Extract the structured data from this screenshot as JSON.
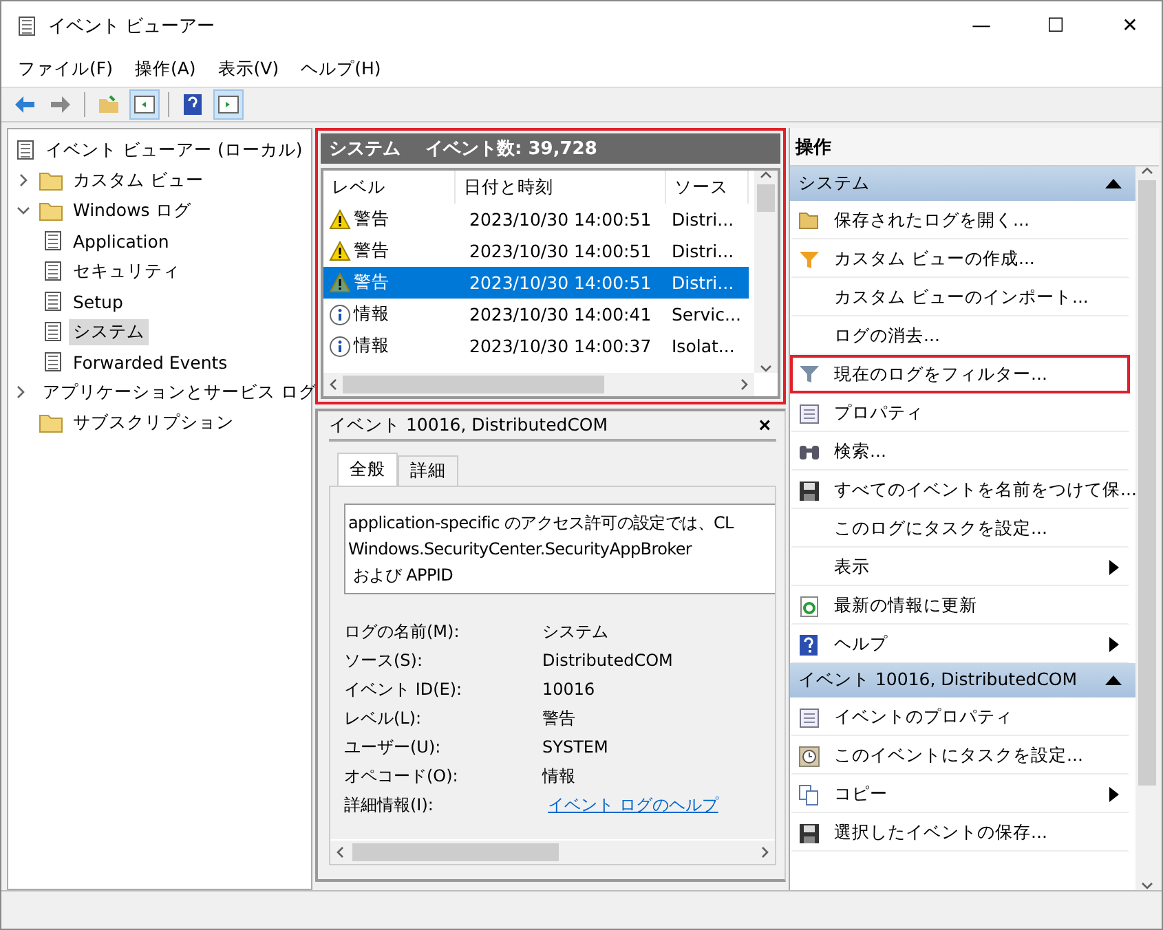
{
  "window": {
    "title": "イベント ビューアー",
    "controls": [
      "—",
      "☐",
      "✕"
    ]
  },
  "menu": [
    "ファイル(F)",
    "操作(A)",
    "表示(V)",
    "ヘルプ(H)"
  ],
  "tree": [
    {
      "label": "イベント ビューアー (ローカル)",
      "selected": false,
      "children": [
        {
          "label": "カスタム ビュー",
          "selected": false,
          "expanded": false
        },
        {
          "label": "Windows ログ",
          "selected": false,
          "expanded": true,
          "children": [
            {
              "label": "Application",
              "selected": false
            },
            {
              "label": "セキュリティ",
              "selected": false
            },
            {
              "label": "Setup",
              "selected": false
            },
            {
              "label": "システム",
              "selected": true
            },
            {
              "label": "Forwarded Events",
              "selected": false
            }
          ]
        },
        {
          "label": "アプリケーションとサービス ログ",
          "selected": false,
          "expanded": false
        },
        {
          "label": "サブスクリプション",
          "selected": false
        }
      ]
    }
  ],
  "log_panel": {
    "title": "システム",
    "count": "イベント数: 39,728",
    "highlight": true,
    "columns": [
      "レベル",
      "日付と時刻",
      "ソース"
    ],
    "rows": [
      {
        "kind": "warning",
        "level": "警告",
        "date": "2023/10/30 14:00:51",
        "source": "Distri...",
        "selected": false
      },
      {
        "kind": "warning",
        "level": "警告",
        "date": "2023/10/30 14:00:51",
        "source": "Distri...",
        "selected": false
      },
      {
        "kind": "warning",
        "level": "警告",
        "date": "2023/10/30 14:00:51",
        "source": "Distri...",
        "selected": true
      },
      {
        "kind": "info",
        "level": "情報",
        "date": "2023/10/30 14:00:41",
        "source": "Servic...",
        "selected": false
      },
      {
        "kind": "info",
        "level": "情報",
        "date": "2023/10/30 14:00:37",
        "source": "Isolat...",
        "selected": false
      }
    ]
  },
  "detail": {
    "title": "イベント 10016, DistributedCOM",
    "close": "×",
    "tabs": [
      {
        "label": "全般",
        "selected": true
      },
      {
        "label": "詳細",
        "selected": false
      }
    ],
    "message": [
      "application-specific のアクセス許可の設定では、CL",
      "Windows.SecurityCenter.SecurityAppBroker",
      " および APPID"
    ],
    "properties": [
      {
        "label": "ログの名前(M):",
        "value": "システム"
      },
      {
        "label": "ソース(S):",
        "value": "DistributedCOM"
      },
      {
        "label": "イベント ID(E):",
        "value": "10016"
      },
      {
        "label": "レベル(L):",
        "value": "警告"
      },
      {
        "label": "ユーザー(U):",
        "value": "SYSTEM"
      },
      {
        "label": "オペコード(O):",
        "value": "情報"
      },
      {
        "label": "詳細情報(I):",
        "value": "イベント ログのヘルプ",
        "kind": "link"
      }
    ]
  },
  "actions": {
    "title": "操作",
    "sections": [
      {
        "title": "システム",
        "expanded": true,
        "items": [
          {
            "label": "保存されたログを開く...",
            "submenu": false,
            "highlight": false
          },
          {
            "label": "カスタム ビューの作成...",
            "submenu": false,
            "highlight": false
          },
          {
            "label": "カスタム ビューのインポート...",
            "submenu": false,
            "highlight": false
          },
          {
            "label": "ログの消去...",
            "submenu": false,
            "highlight": false
          },
          {
            "label": "現在のログをフィルター...",
            "submenu": false,
            "highlight": true
          },
          {
            "label": "プロパティ",
            "submenu": false,
            "highlight": false
          },
          {
            "label": "検索...",
            "submenu": false,
            "highlight": false
          },
          {
            "label": "すべてのイベントを名前をつけて保...",
            "submenu": false,
            "highlight": false
          },
          {
            "label": "このログにタスクを設定...",
            "submenu": false,
            "highlight": false
          },
          {
            "label": "表示",
            "submenu": true,
            "highlight": false
          },
          {
            "label": "最新の情報に更新",
            "submenu": false,
            "highlight": false
          },
          {
            "label": "ヘルプ",
            "submenu": true,
            "highlight": false
          }
        ]
      },
      {
        "title": "イベント 10016, DistributedCOM",
        "expanded": true,
        "items": [
          {
            "label": "イベントのプロパティ",
            "submenu": false,
            "highlight": false
          },
          {
            "label": "このイベントにタスクを設定...",
            "submenu": false,
            "highlight": false
          },
          {
            "label": "コピー",
            "submenu": true,
            "highlight": false
          },
          {
            "label": "選択したイベントの保存...",
            "submenu": false,
            "highlight": false
          }
        ]
      }
    ]
  }
}
